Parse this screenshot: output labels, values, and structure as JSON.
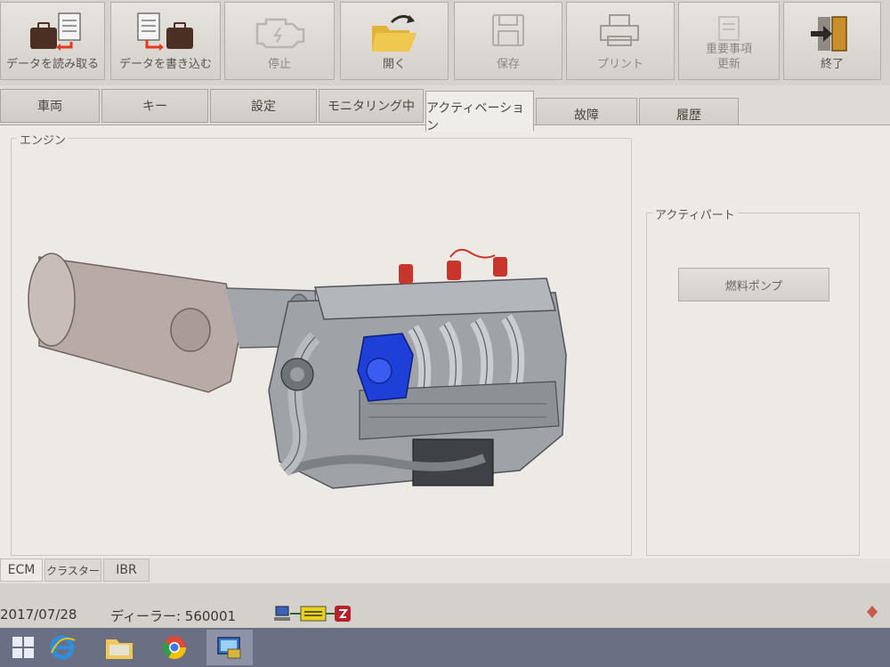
{
  "toolbar": {
    "buttons": [
      {
        "id": "read",
        "label": "データを読み取る",
        "icon": "briefcase-to-document-icon"
      },
      {
        "id": "write",
        "label": "データを書き込む",
        "icon": "document-to-briefcase-icon"
      },
      {
        "id": "stop",
        "label": "停止",
        "icon": "engine-icon"
      },
      {
        "id": "open",
        "label": "開く",
        "icon": "open-folder-icon"
      },
      {
        "id": "save",
        "label": "保存",
        "icon": "floppy-disk-icon"
      },
      {
        "id": "print",
        "label": "プリント",
        "icon": "printer-icon"
      },
      {
        "id": "update",
        "label": "重要事項\n更新",
        "icon": "update-icon"
      },
      {
        "id": "exit",
        "label": "終了",
        "icon": "exit-door-icon"
      }
    ]
  },
  "tabs": [
    "車両",
    "キー",
    "設定",
    "モニタリング中",
    "アクティベーション",
    "故障",
    "履歴"
  ],
  "active_tab": "アクティベーション",
  "main": {
    "engine_group_title": "エンジン",
    "active_parts_title": "アクティパート",
    "fuel_pump_button": "燃料ポンプ"
  },
  "subtabs": [
    "ECM",
    "クラスター",
    "IBR"
  ],
  "status": {
    "date": "2017/07/28",
    "dealer": "ディーラー: 560001"
  },
  "colors": {
    "window_bg": "#edeae6",
    "toolbar_bg": "#d6d2cd",
    "taskbar_bg": "#6b6f84",
    "highlight_part": "#1e3fd8",
    "ignition_coil": "#c8352b"
  }
}
